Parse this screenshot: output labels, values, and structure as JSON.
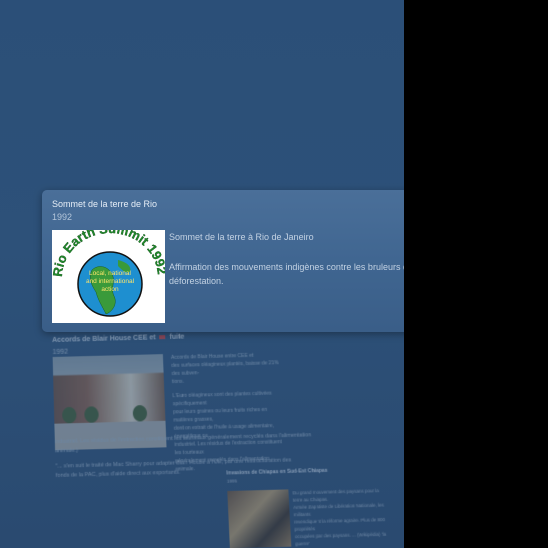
{
  "card": {
    "title": "Sommet de la terre de Rio",
    "year": "1992",
    "subtitle": "Sommet de la terre à Rio de Janeiro",
    "description": "Affirmation des mouvements indigènes contre les bruleurs de terre et la déforestation.",
    "logo": {
      "arc_text": "Rio Earth Summit 1992",
      "center_text": [
        "Local, national",
        "and international",
        "action"
      ]
    }
  },
  "background_card": {
    "title": "Accords de Blair House CEE et",
    "title_tag": "fuite",
    "year": "1992",
    "para_lines": [
      "Accords de Blair House entre CEE et",
      "des surfaces oléagineux plantés, baisse de 21% des subven-",
      "tions."
    ],
    "para2_lines": [
      "L'Euro oléagineux sont des plantes cultivées spécifiquement",
      "pour leurs graines ou leurs fruits riches en matières grasses,",
      "dont on extrait de l'huile à usage alimentaire, énergétique ou",
      "industriel. Les résidus de l'extraction constituent les tourteaux",
      "généralement recyclés dans l'alimentation animale."
    ],
    "footer_lines": [
      "industriel. Les résidus de l'extraction constituent les tourteaux généralement recyclés dans l'alimentation",
      "animale.)",
      "\"... s'en suit le traité de Mac Sharry pour adapter Blair House à l'UE, par une restructuration des",
      "fonds de la PAC, plus d'aide direct aux exportants."
    ],
    "sub_title": "Invasions de Chiapas en Sud-Est Chiapas",
    "sub_year": "1995",
    "sub_lines": [
      "Du grand mouvement des paysans pour la terre au Chiapas.",
      "Armée Zapatiste de Libération Nationale, les militants",
      "revendiquent la réforme agraire. Plus de 800 propriétés",
      "occupées par des paysans. ... (Wikipédia) 'la guerre'"
    ]
  }
}
